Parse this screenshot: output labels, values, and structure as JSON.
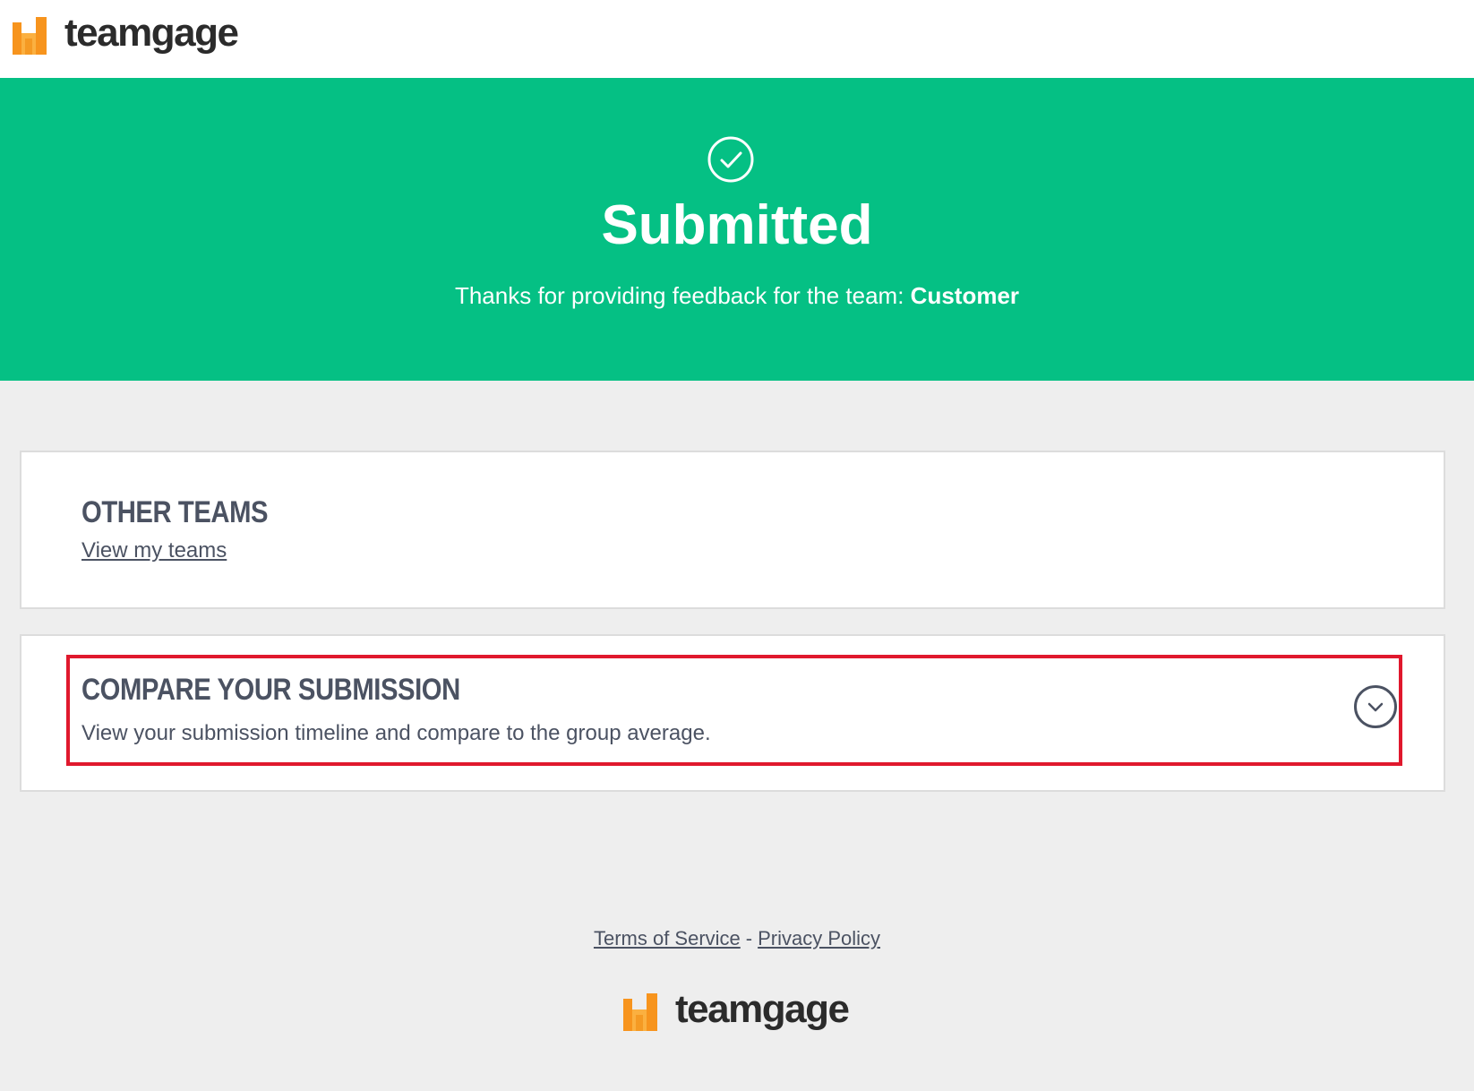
{
  "header": {
    "logo_text": "teamgage"
  },
  "hero": {
    "title": "Submitted",
    "message_prefix": "Thanks for providing feedback for the team: ",
    "team_name": "Customer"
  },
  "other_teams": {
    "heading": "OTHER TEAMS",
    "link_label": "View my teams"
  },
  "compare": {
    "heading": "COMPARE YOUR SUBMISSION",
    "description": "View your submission timeline and compare to the group average."
  },
  "footer": {
    "terms_label": "Terms of Service",
    "separator": "-",
    "privacy_label": "Privacy Policy",
    "logo_text": "teamgage"
  },
  "colors": {
    "hero_green": "#05c084",
    "logo_orange": "#f7941d",
    "highlight_red": "#e0182d",
    "text_slate": "#4b5262"
  }
}
